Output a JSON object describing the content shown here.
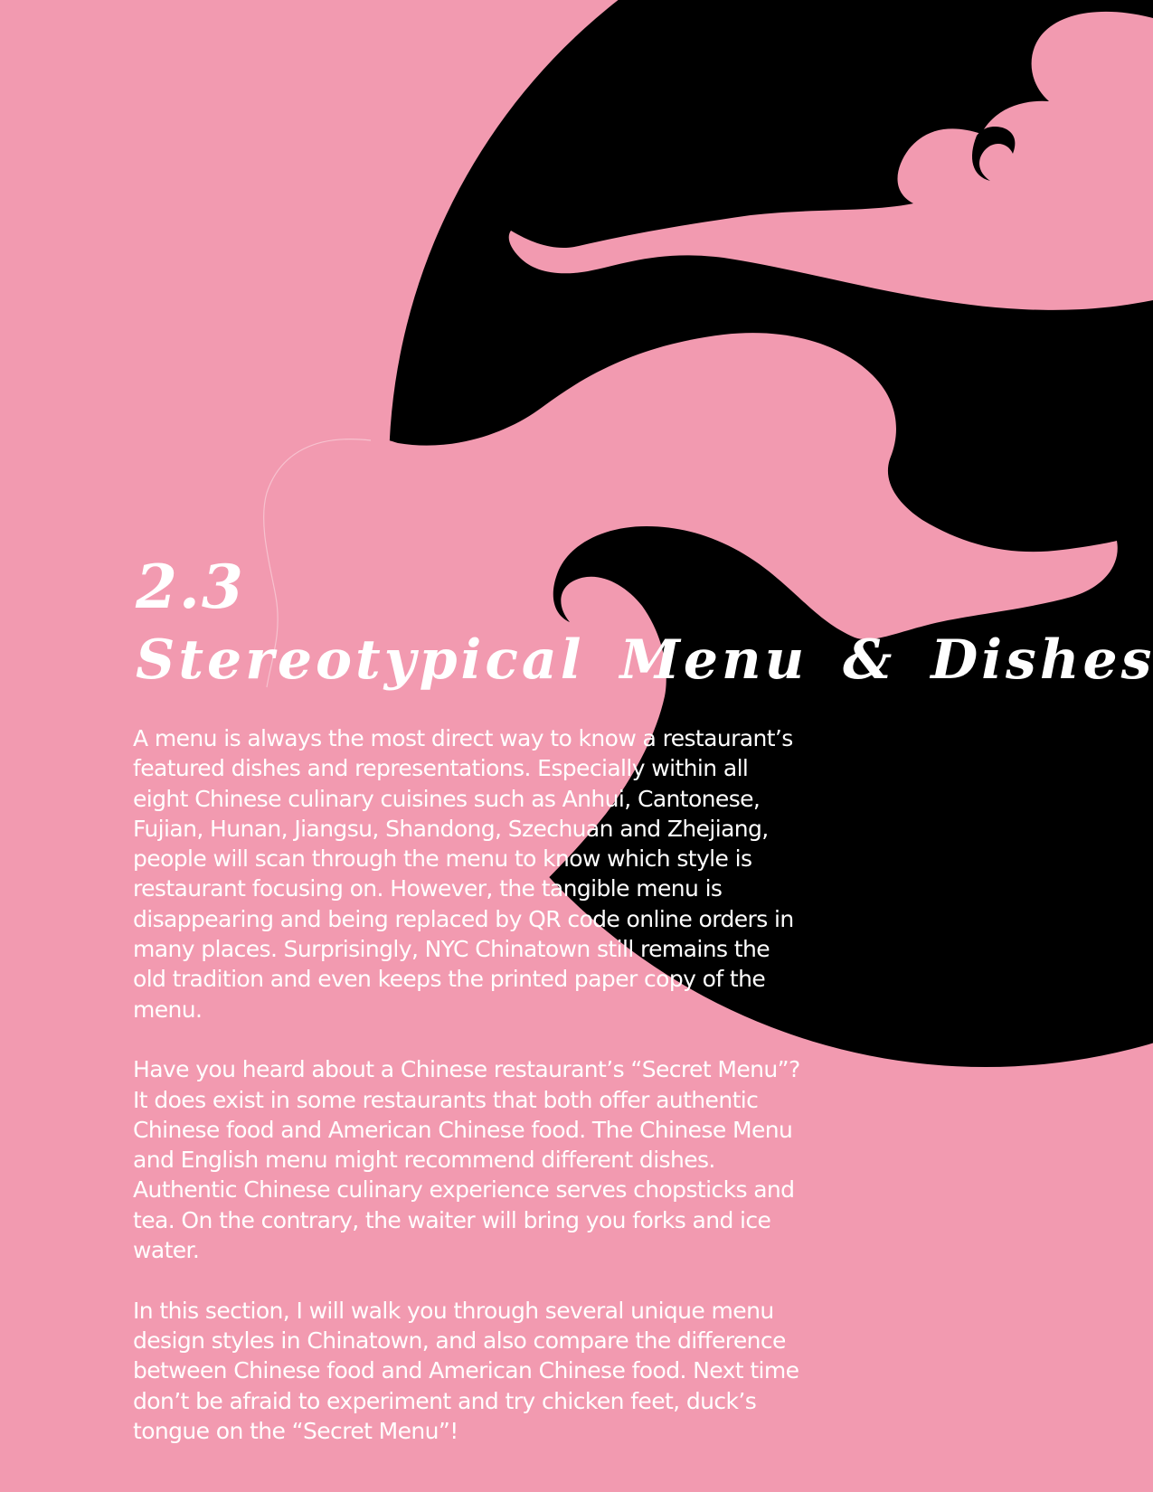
{
  "colors": {
    "background": "#f29ab0",
    "wave": "#000000",
    "text": "#ffffff"
  },
  "decoration": {
    "name": "black-cloud-wave-graphic"
  },
  "heading": {
    "section_number": "2.3",
    "title": "Stereotypical Menu & Dishes"
  },
  "paragraphs": [
    "A menu is always the most direct way to know a restaurant’s featured dishes and representations. Especially within all eight Chinese culinary cuisines such as Anhui, Cantonese, Fujian, Hunan, Jiangsu, Shandong, Szechuan and Zhejiang, people will scan through the menu to know which style is restaurant focusing on. However, the tangible menu is disappearing and being replaced by QR code online orders in many places. Surprisingly, NYC Chinatown still remains the old tradition and even keeps the printed paper copy of the menu.",
    "Have you heard about a Chinese restaurant’s “Secret Menu”? It does exist in some restaurants that both offer authentic Chinese food and American Chinese food. The Chinese Menu and English menu might recommend different dishes. Authentic Chinese culinary experience serves chopsticks and tea. On the contrary, the waiter will bring you forks and ice water.",
    "In this section, I will walk you through several unique menu design styles in Chinatown, and also compare the difference between Chinese food and American Chinese food. Next time don’t be afraid to experiment and try chicken feet, duck’s tongue on the “Secret Menu”!"
  ]
}
